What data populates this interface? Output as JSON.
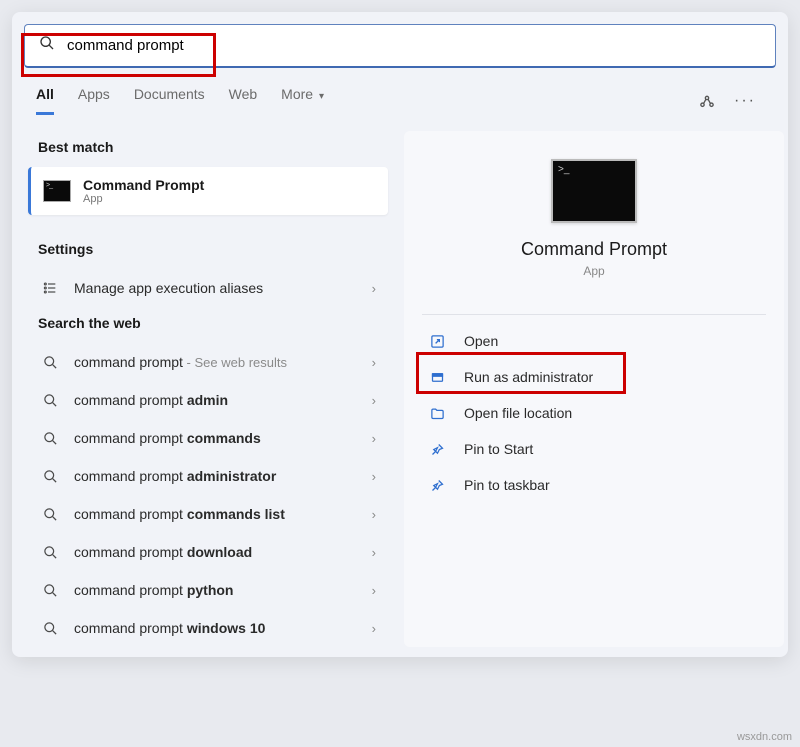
{
  "search": {
    "value": "command prompt"
  },
  "tabs": {
    "all": "All",
    "apps": "Apps",
    "documents": "Documents",
    "web": "Web",
    "more": "More"
  },
  "left": {
    "best_head": "Best match",
    "best": {
      "title": "Command Prompt",
      "subtitle": "App"
    },
    "settings_head": "Settings",
    "settings_item": "Manage app execution aliases",
    "web_head": "Search the web",
    "web_items": [
      {
        "prefix": "command prompt",
        "bold": "",
        "hint": " - See web results"
      },
      {
        "prefix": "command prompt ",
        "bold": "admin",
        "hint": ""
      },
      {
        "prefix": "command prompt ",
        "bold": "commands",
        "hint": ""
      },
      {
        "prefix": "command prompt ",
        "bold": "administrator",
        "hint": ""
      },
      {
        "prefix": "command prompt ",
        "bold": "commands list",
        "hint": ""
      },
      {
        "prefix": "command prompt ",
        "bold": "download",
        "hint": ""
      },
      {
        "prefix": "command prompt ",
        "bold": "python",
        "hint": ""
      },
      {
        "prefix": "command prompt ",
        "bold": "windows 10",
        "hint": ""
      }
    ]
  },
  "right": {
    "title": "Command Prompt",
    "subtitle": "App",
    "actions": {
      "open": "Open",
      "run_admin": "Run as administrator",
      "open_loc": "Open file location",
      "pin_start": "Pin to Start",
      "pin_taskbar": "Pin to taskbar"
    }
  },
  "watermark": "wsxdn.com"
}
